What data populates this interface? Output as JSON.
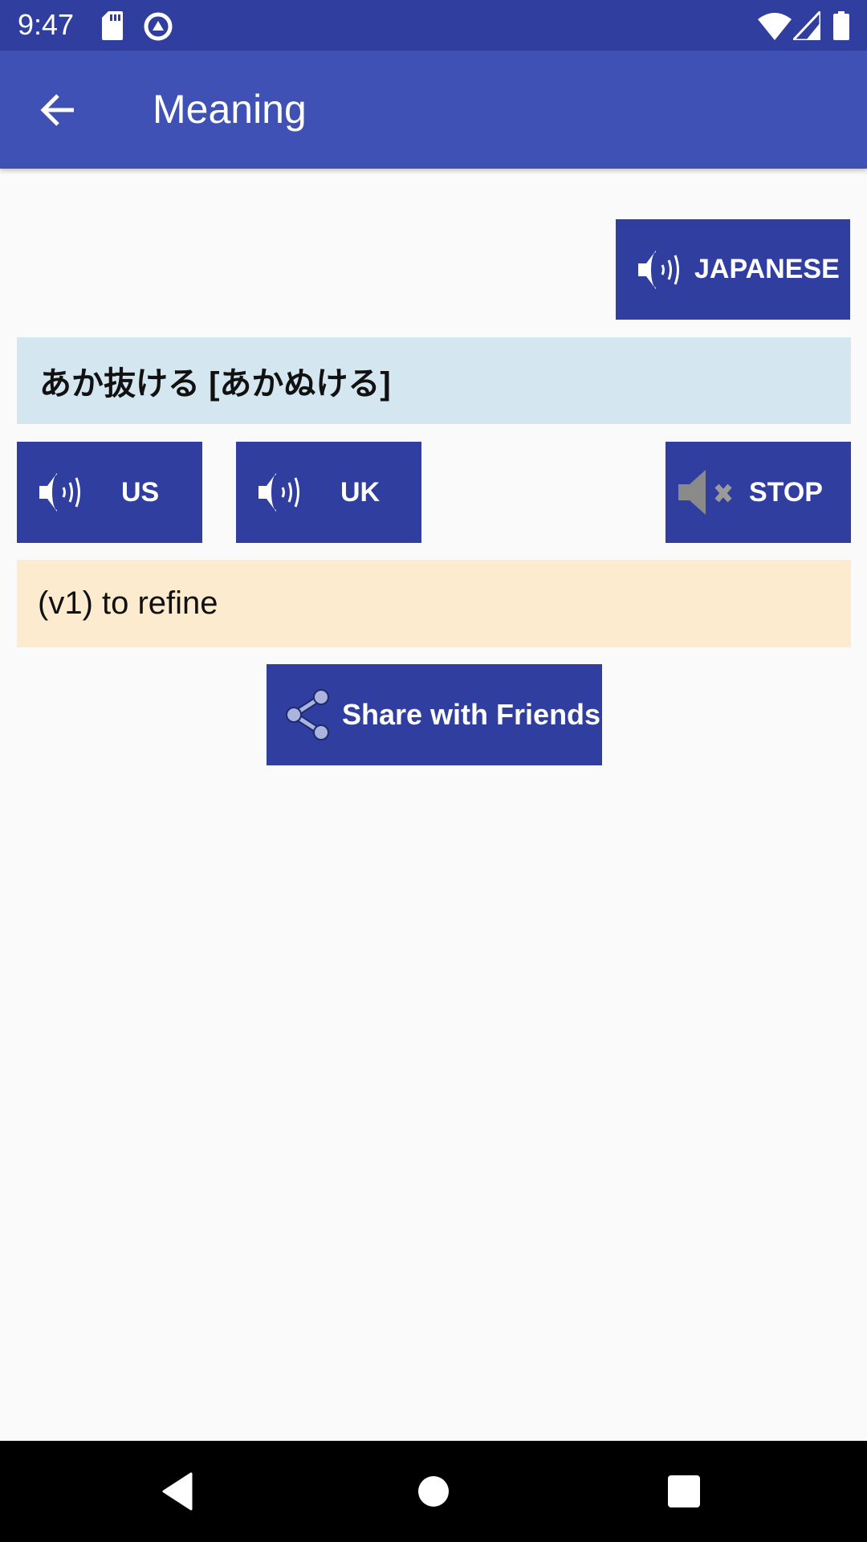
{
  "status_bar": {
    "time": "9:47",
    "left_icons": [
      "sd-card-icon",
      "data-saver-icon"
    ],
    "right_icons": [
      "wifi-icon",
      "cell-signal-icon",
      "battery-icon"
    ]
  },
  "app_bar": {
    "back_icon": "arrow-back-icon",
    "title": "Meaning"
  },
  "buttons": {
    "japanese": {
      "label": "JAPANESE",
      "icon": "speaker-icon"
    },
    "us": {
      "label": "US",
      "icon": "speaker-icon"
    },
    "uk": {
      "label": "UK",
      "icon": "speaker-icon"
    },
    "stop": {
      "label": "STOP",
      "icon": "speaker-mute-icon"
    },
    "share": {
      "label": "Share with Friends",
      "icon": "share-icon"
    }
  },
  "word": "あか抜ける [あかぬける]",
  "meaning": "(v1) to refine",
  "colors": {
    "status_bar": "#303f9f",
    "app_bar": "#3f51b5",
    "button": "#303f9f",
    "word_bg": "#d4e6f0",
    "meaning_bg": "#fdebd0"
  },
  "nav_bar": {
    "items": [
      "back-icon",
      "home-icon",
      "recents-icon"
    ]
  }
}
